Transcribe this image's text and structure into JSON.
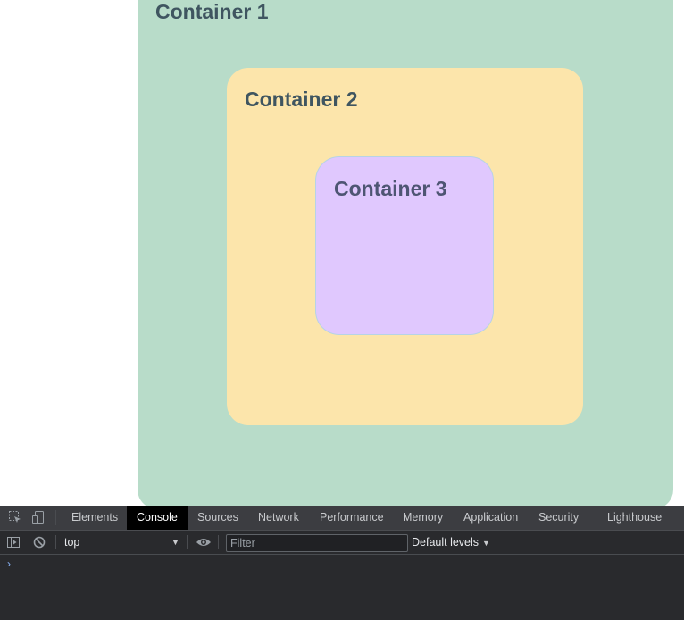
{
  "containers": {
    "c1_title": "Container 1",
    "c2_title": "Container 2",
    "c3_title": "Container 3"
  },
  "devtools": {
    "tabs": [
      "Elements",
      "Console",
      "Sources",
      "Network",
      "Performance",
      "Memory",
      "Application",
      "Security",
      "Lighthouse"
    ],
    "active_tab": "Console",
    "context": "top",
    "filter_placeholder": "Filter",
    "levels": "Default levels",
    "prompt": "›",
    "icons": [
      "inspect-element-icon",
      "device-toggle-icon",
      "sidebar-toggle-icon",
      "clear-console-icon",
      "eye-icon",
      "dropdown-arrow-icon"
    ]
  },
  "colors": {
    "container1": "#b8dcc9",
    "container2": "#fce5ab",
    "container3": "#e0c8fe",
    "devtools_bg": "#292a2d"
  }
}
